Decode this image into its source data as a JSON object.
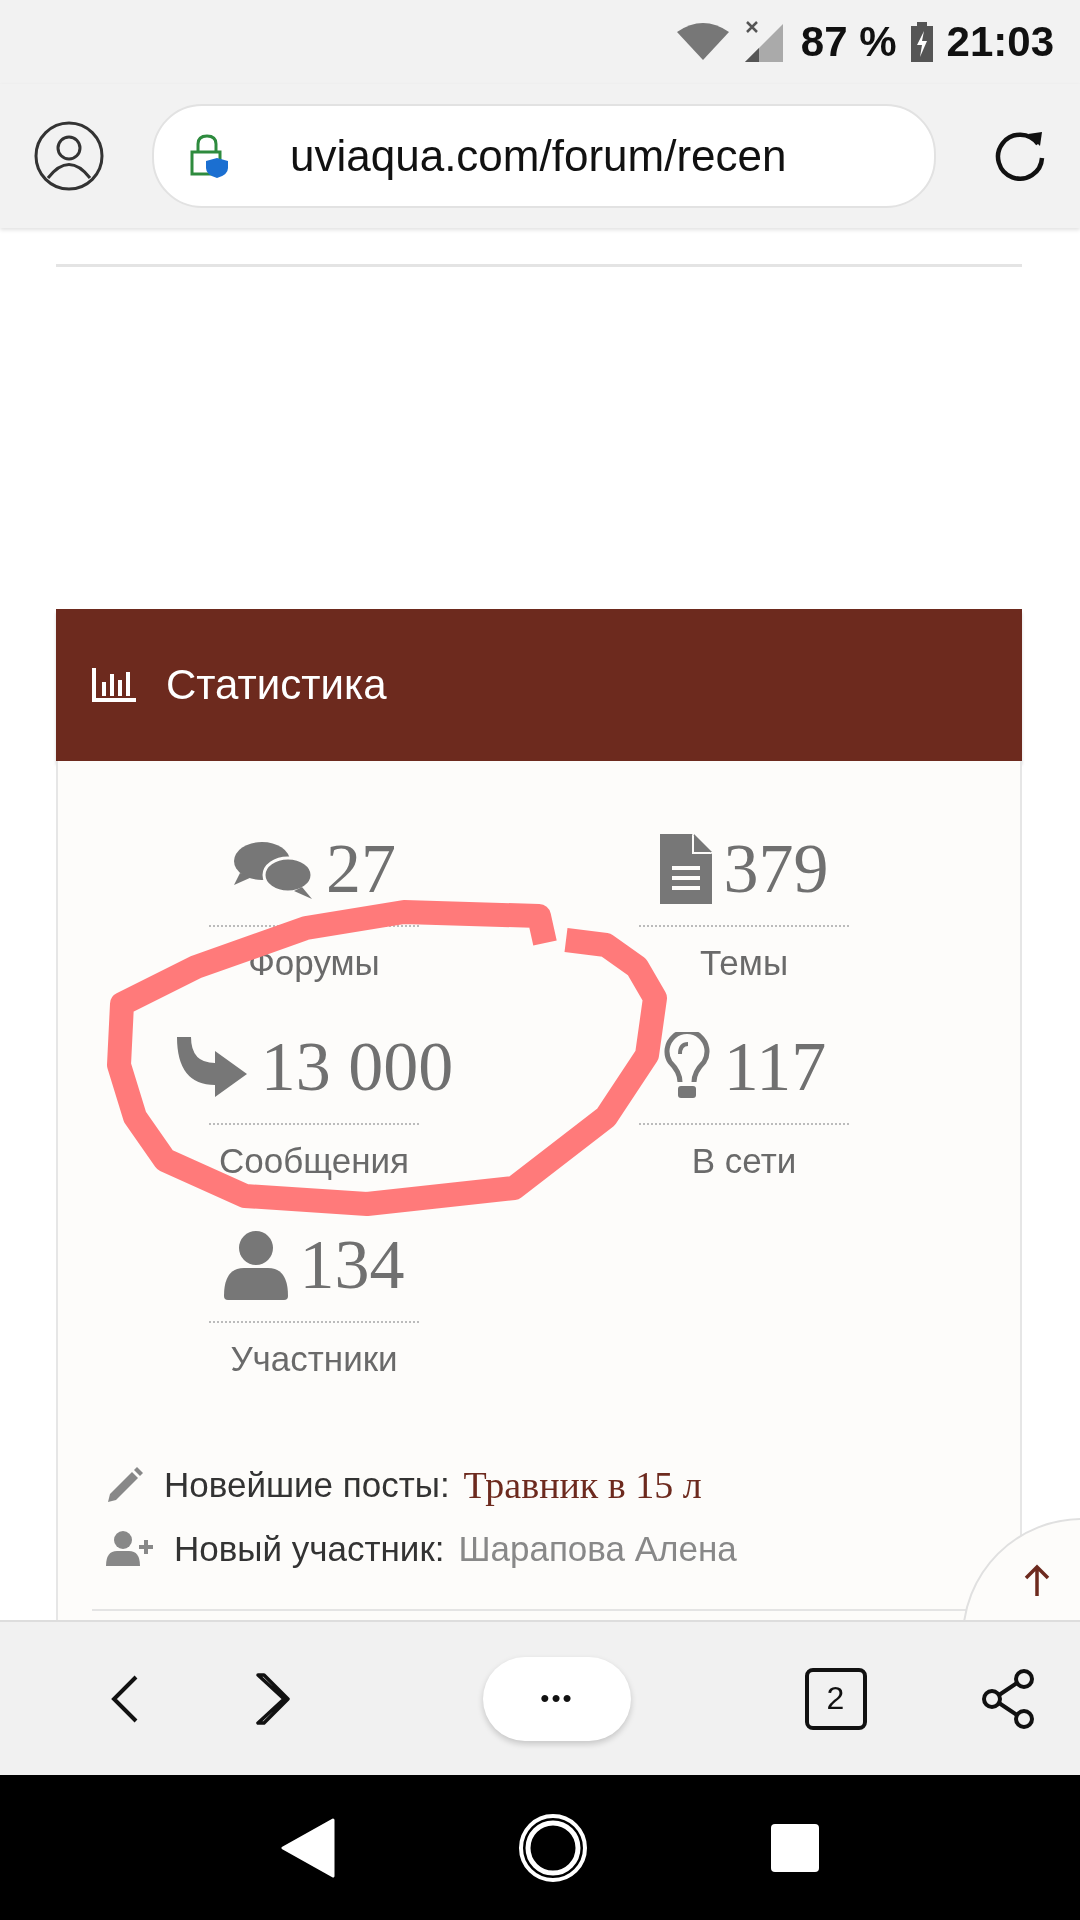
{
  "status_bar": {
    "battery": "87 %",
    "time": "21:03"
  },
  "browser": {
    "url": "uviaqua.com/forum/recen"
  },
  "stats": {
    "title": "Статистика",
    "items": [
      {
        "kind": "forums",
        "value": "27",
        "label": "Форумы"
      },
      {
        "kind": "topics",
        "value": "379",
        "label": "Темы"
      },
      {
        "kind": "posts",
        "value": "13 000",
        "label": "Сообщения"
      },
      {
        "kind": "online",
        "value": "117",
        "label": "В сети"
      },
      {
        "kind": "members",
        "value": "134",
        "label": "Участники"
      }
    ]
  },
  "latest": [
    {
      "kind": "post",
      "label": "Новейшие посты:",
      "value": "Травник в 15 л"
    },
    {
      "kind": "member",
      "label": "Новый участник:",
      "value": "Шарапова Алена"
    }
  ],
  "toolbar": {
    "tab_count": "2",
    "menu": "•••"
  },
  "annotation": {
    "kind": "freehand-circle"
  }
}
